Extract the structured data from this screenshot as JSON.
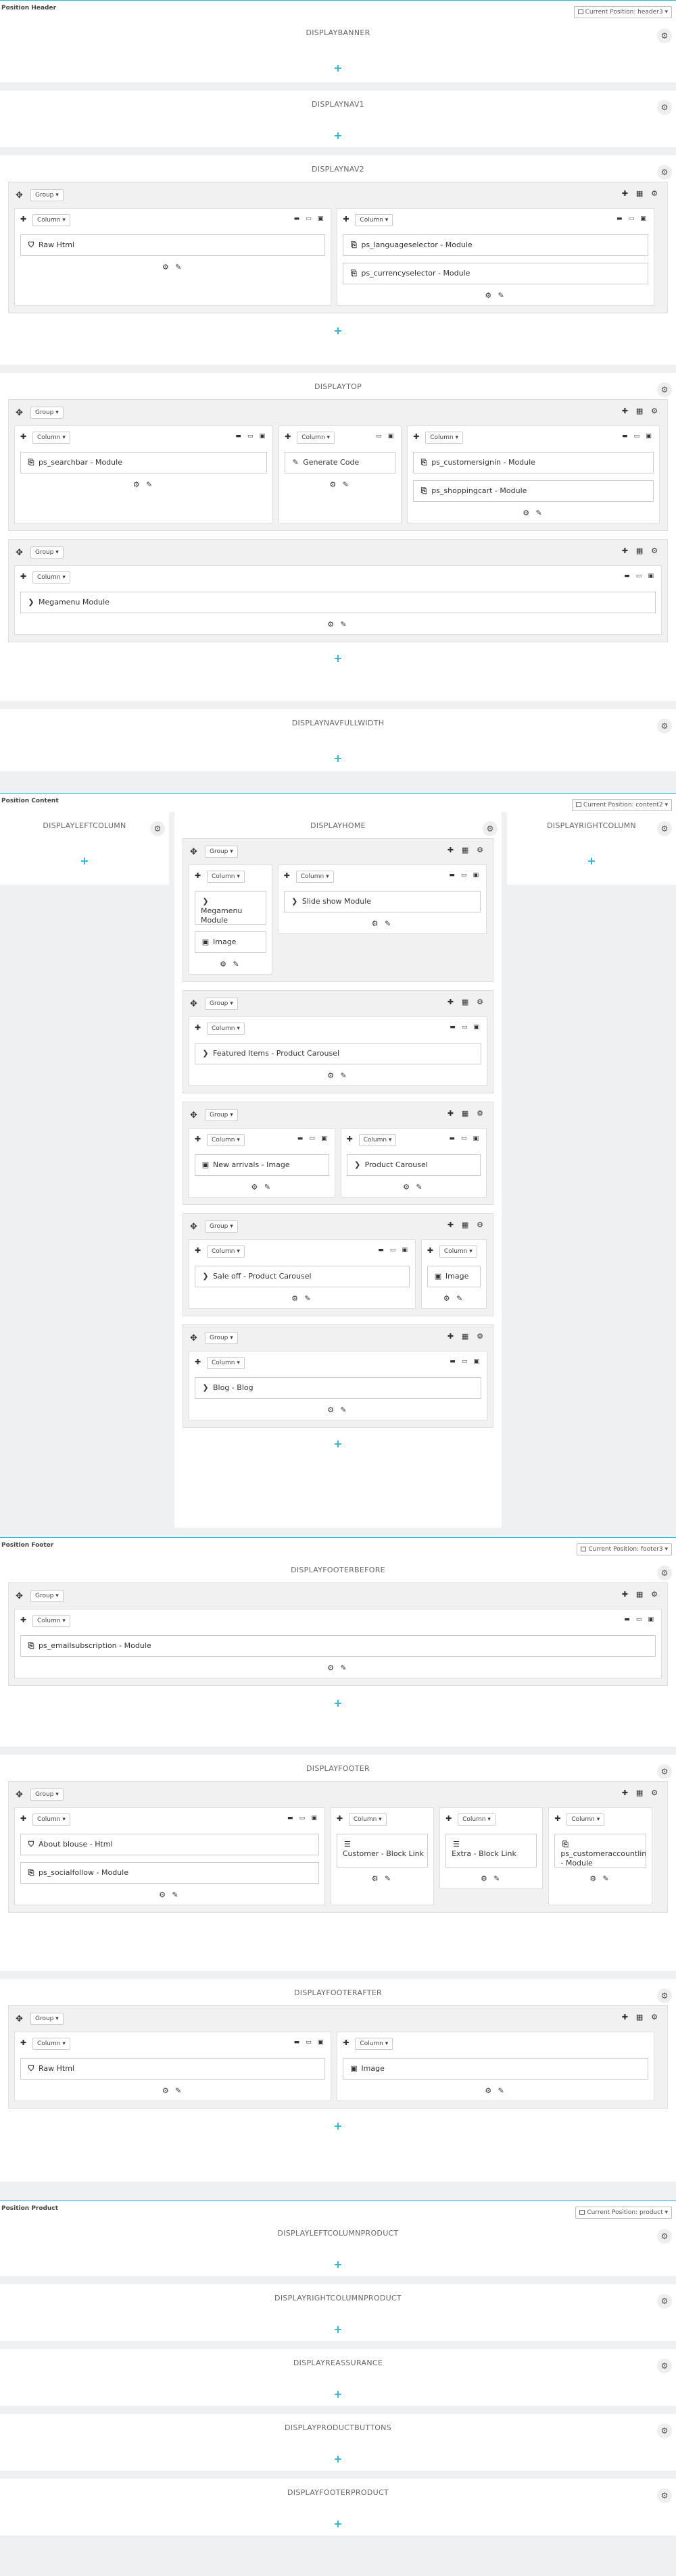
{
  "sections": {
    "header": {
      "title": "Position Header",
      "select": "Current Position: header3"
    },
    "content": {
      "title": "Position Content",
      "select": "Current Position: content2"
    },
    "footer": {
      "title": "Position Footer",
      "select": "Current Position: footer3"
    },
    "product": {
      "title": "Position Product",
      "select": "Current Position: product"
    }
  },
  "labels": {
    "group": "Group",
    "column": "Column",
    "add": "+"
  },
  "hooks": {
    "displaybanner": "DISPLAYBANNER",
    "displaynav1": "DISPLAYNAV1",
    "displaynav2": "DISPLAYNAV2",
    "displaytop": "DISPLAYTOP",
    "displaynavfullwidth": "DISPLAYNAVFULLWIDTH",
    "displayleftcolumn": "DISPLAYLEFTCOLUMN",
    "displayhome": "DISPLAYHOME",
    "displayrightcolumn": "DISPLAYRIGHTCOLUMN",
    "displayfooterbefore": "DISPLAYFOOTERBEFORE",
    "displayfooter": "DISPLAYFOOTER",
    "displayfooterafter": "DISPLAYFOOTERAFTER",
    "displayleftcolumnproduct": "DISPLAYLEFTCOLUMNPRODUCT",
    "displayrightcolumnproduct": "DISPLAYRIGHTCOLUMNPRODUCT",
    "displayreassurance": "DISPLAYREASSURANCE",
    "displayproductbuttons": "DISPLAYPRODUCTBUTTONS",
    "displayfooterproduct": "DISPLAYFOOTERPRODUCT"
  },
  "modules": {
    "raw_html": "Raw Html",
    "languageselector": "ps_languageselector - Module",
    "currencyselector": "ps_currencyselector - Module",
    "searchbar": "ps_searchbar - Module",
    "generate_code": "Generate Code",
    "customersignin": "ps_customersignin - Module",
    "shoppingcart": "ps_shoppingcart - Module",
    "megamenu": "Megamenu Module",
    "megamenu_short": "Megamenu Module",
    "image": "Image",
    "slideshow": "Slide show Module",
    "featured": "Featured Items - Product Carousel",
    "new_arrivals": "New arrivals - Image",
    "product_carousel": "Product Carousel",
    "sale_off": "Sale off - Product Carousel",
    "blog": "Blog - Blog",
    "emailsubscription": "ps_emailsubscription - Module",
    "about_blouse": "About blouse - Html",
    "socialfollow": "ps_socialfollow - Module",
    "customer_block": "Customer - Block Link",
    "extra_block": "Extra - Block Link",
    "customeraccountlinks": "ps_customeraccountlinks - Module"
  },
  "icons": {
    "move": "move-icon",
    "gear": "gear-icon",
    "edit": "pencil-icon",
    "add": "plus-icon",
    "dropdown": "caret-down-icon"
  }
}
